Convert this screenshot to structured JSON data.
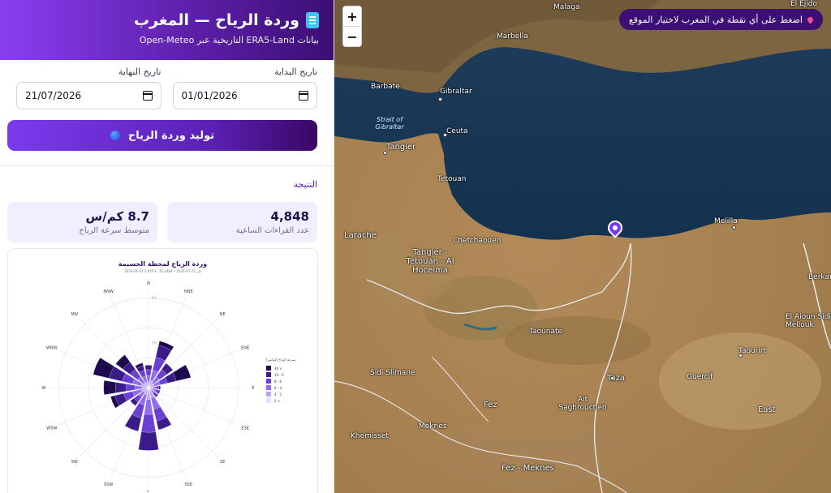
{
  "header": {
    "title": "وردة الرياح — المغرب",
    "subtitle": "بيانات ERA5-Land التاريخية عبر Open-Meteo"
  },
  "dates": {
    "start_label": "تاريخ البداية",
    "start_value": "01/01/2026",
    "end_label": "تاريخ النهاية",
    "end_value": "21/07/2026"
  },
  "generate_button": "توليد وردة الرياح",
  "result": {
    "label": "النتيجة",
    "readings_value": "4,848",
    "readings_label": "عدد القراءات الساعية",
    "speed_value": "8.7 كم/س",
    "speed_label": "متوسط سرعة الرياح"
  },
  "chart_data": {
    "type": "windrose",
    "title": "وردة الرياح لمحطة الحسيمة",
    "subtitle": "2026-01-01 إلى 21-07-2026 • 35.2484 ،-3.9253",
    "directions": [
      "N",
      "NNE",
      "NE",
      "ENE",
      "E",
      "ESE",
      "SE",
      "SSE",
      "S",
      "SSW",
      "SW",
      "WSW",
      "W",
      "WNW",
      "NW",
      "NNW"
    ],
    "ring_labels": [
      "3%",
      "6%"
    ],
    "legend_title": "سرعة الرياح (كم/س)",
    "speed_bins": [
      "30 <",
      "10 - 6",
      "8 - 6",
      "6 - 4",
      "4 - 2",
      "2 >"
    ],
    "colors": [
      "#1e0a4e",
      "#3b1a8a",
      "#6a3fd3",
      "#8f6cf0",
      "#b9a3f7",
      "#e6defc"
    ],
    "series": [
      {
        "name": "30 <",
        "values": [
          0,
          0.3,
          0,
          1.0,
          0,
          0,
          0,
          0,
          0,
          0,
          0,
          0.3,
          0.8,
          1.1,
          0.6,
          0.2
        ]
      },
      {
        "name": "10 - 6",
        "values": [
          0.3,
          0.8,
          0.5,
          0.6,
          0.1,
          0.1,
          0.1,
          0.6,
          1.2,
          0.9,
          0.3,
          0.6,
          0.7,
          0.9,
          0.6,
          0.3
        ]
      },
      {
        "name": "8 - 6",
        "values": [
          0.4,
          0.9,
          0.6,
          0.5,
          0.2,
          0.2,
          0.2,
          0.8,
          1.2,
          0.9,
          0.4,
          0.6,
          0.6,
          0.7,
          0.6,
          0.4
        ]
      },
      {
        "name": "6 - 4",
        "values": [
          0.4,
          0.7,
          0.5,
          0.4,
          0.2,
          0.2,
          0.2,
          0.8,
          1.0,
          0.7,
          0.4,
          0.6,
          0.5,
          0.6,
          0.5,
          0.4
        ]
      },
      {
        "name": "4 - 2",
        "values": [
          0.3,
          0.4,
          0.3,
          0.3,
          0.2,
          0.2,
          0.2,
          0.5,
          0.6,
          0.4,
          0.3,
          0.4,
          0.3,
          0.4,
          0.3,
          0.3
        ]
      },
      {
        "name": "2 >",
        "values": [
          0.1,
          0.1,
          0.1,
          0.1,
          0.1,
          0.1,
          0.1,
          0.2,
          0.2,
          0.1,
          0.1,
          0.1,
          0.1,
          0.1,
          0.1,
          0.1
        ]
      }
    ]
  },
  "map": {
    "hint": "اضغط على أي نقطة في المغرب لاختيار الموقع",
    "zoom_in": "+",
    "zoom_out": "−",
    "places": [
      "Malaga",
      "Marbella",
      "Gibraltar",
      "Barbate",
      "Ceuta",
      "Tangier",
      "Tetouan",
      "Chefchaouen",
      "Tangier - Tetouan - Al Hoceima",
      "Larache",
      "Melilla",
      "Taounate",
      "Taza",
      "Sidi Slimane",
      "Fez",
      "Ait Saghrouchen",
      "Guercif",
      "Taourirt",
      "Khemisset",
      "Meknes",
      "Fez - Meknes",
      "East",
      "El Aioun Sidi Mellouk",
      "El Ejido",
      "Berkane",
      "Strait of Gibraltar"
    ]
  }
}
